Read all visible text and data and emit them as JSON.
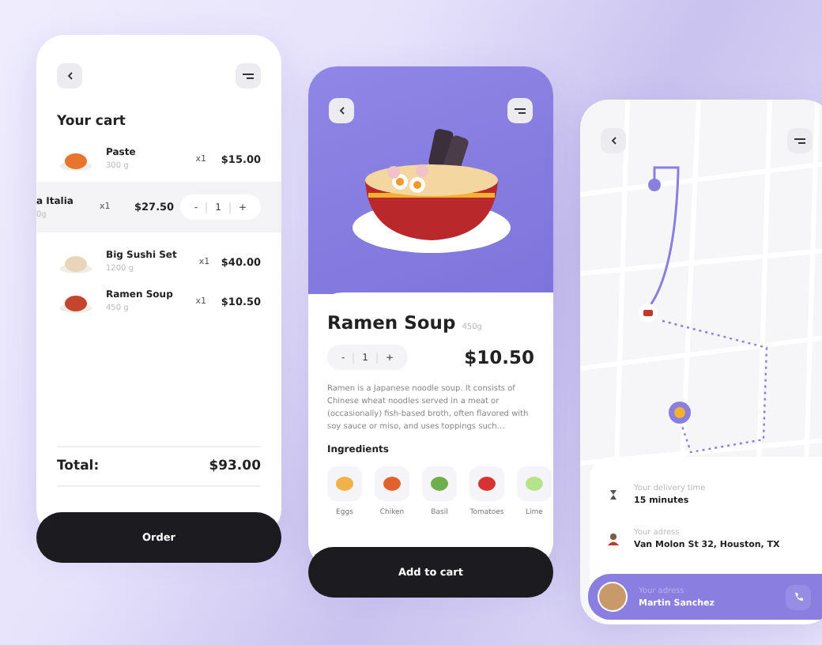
{
  "cart_screen": {
    "title": "Your cart",
    "items": [
      {
        "kind": "normal",
        "name": "Paste",
        "weight": "300 g",
        "qty": "x1",
        "price": "$15.00"
      },
      {
        "kind": "swiped",
        "name": "a Italia",
        "weight": "0g",
        "qty": "x1",
        "price": "$27.50",
        "stepper": {
          "minus": "-",
          "value": "1",
          "plus": "+"
        }
      },
      {
        "kind": "normal",
        "name": "Big Sushi Set",
        "weight": "1200 g",
        "qty": "x1",
        "price": "$40.00"
      },
      {
        "kind": "normal",
        "name": "Ramen Soup",
        "weight": "450 g",
        "qty": "x1",
        "price": "$10.50"
      }
    ],
    "total_label": "Total:",
    "total": "$93.00",
    "button": "Order"
  },
  "product_screen": {
    "name": "Ramen Soup",
    "weight": "450g",
    "stepper": {
      "minus": "-",
      "value": "1",
      "plus": "+"
    },
    "price": "$10.50",
    "description": "Ramen is a Japanese noodle soup. It consists of Chinese wheat noodles served in a meat or (occasionally) fish-based broth, often flavored with soy sauce or miso, and uses toppings such…",
    "ingredients_title": "Ingredients",
    "ingredients": [
      "Eggs",
      "Chiken",
      "Basil",
      "Tomatoes",
      "Lime"
    ],
    "button": "Add to cart"
  },
  "tracking_screen": {
    "delivery_time_label": "Your delivery time",
    "delivery_time": "15 minutes",
    "address_label": "Your adress",
    "address": "Van Molon St 32, Houston, TX",
    "courier_label": "Your adress",
    "courier_name": "Martin Sanchez"
  }
}
